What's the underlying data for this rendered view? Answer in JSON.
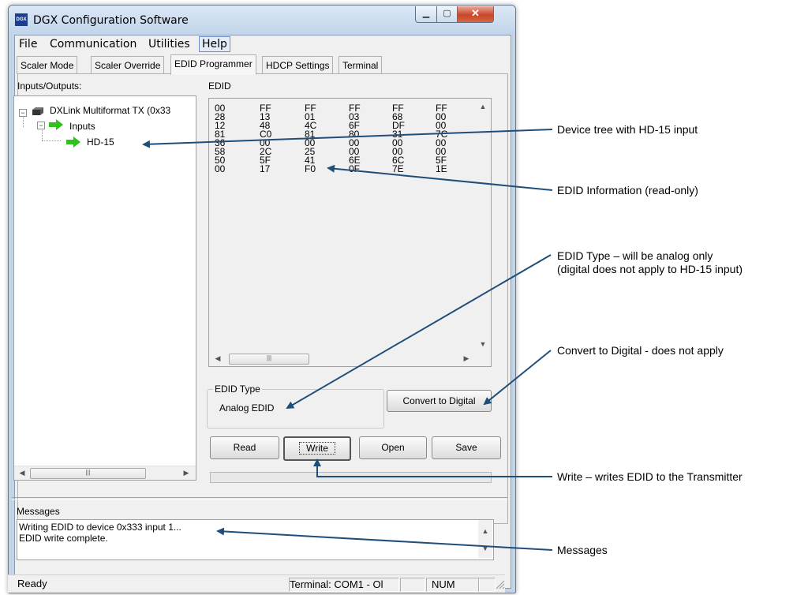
{
  "window": {
    "title": "DGX Configuration Software",
    "app_icon_text": "DGX"
  },
  "menu": [
    "File",
    "Communication",
    "Utilities",
    "Help"
  ],
  "tabs": [
    "Scaler Mode",
    "Scaler Override",
    "EDID Programmer",
    "HDCP Settings",
    "Terminal"
  ],
  "active_tab": "EDID Programmer",
  "left": {
    "label": "Inputs/Outputs:",
    "tree": {
      "device": "DXLink Multiformat TX (0x33",
      "inputs": "Inputs",
      "port": "HD-15"
    }
  },
  "edid": {
    "label": "EDID",
    "rows": [
      [
        "00",
        "FF",
        "FF",
        "FF",
        "FF",
        "FF"
      ],
      [
        "28",
        "13",
        "01",
        "03",
        "68",
        "00"
      ],
      [
        "12",
        "48",
        "4C",
        "6F",
        "DF",
        "00"
      ],
      [
        "81",
        "C0",
        "81",
        "80",
        "31",
        "7C"
      ],
      [
        "36",
        "00",
        "00",
        "00",
        "00",
        "00"
      ],
      [
        "58",
        "2C",
        "25",
        "00",
        "00",
        "00"
      ],
      [
        "50",
        "5F",
        "41",
        "6E",
        "6C",
        "5F"
      ],
      [
        "00",
        "17",
        "F0",
        "0F",
        "7E",
        "1E"
      ]
    ]
  },
  "edid_type": {
    "legend": "EDID Type",
    "value": "Analog EDID"
  },
  "buttons": {
    "convert": "Convert to Digital",
    "read": "Read",
    "write": "Write",
    "open": "Open",
    "save": "Save"
  },
  "messages": {
    "label": "Messages",
    "lines": [
      "Writing EDID to device 0x333 input 1...",
      "EDID write complete."
    ]
  },
  "status": {
    "ready": "Ready",
    "terminal": "Terminal: COM1 - Ol",
    "num": "NUM"
  },
  "annotations": {
    "device_tree": "Device tree with HD-15 input",
    "edid_info": "EDID Information (read-only)",
    "edid_type_line1": "EDID Type – will be analog only",
    "edid_type_line2": "(digital does not apply to HD-15 input)",
    "convert": "Convert to Digital - does not apply",
    "write": "Write – writes EDID to the Transmitter",
    "messages": "Messages"
  },
  "colors": {
    "arrow": "#1f4e79",
    "tree_arrow": "#2ec21b"
  }
}
